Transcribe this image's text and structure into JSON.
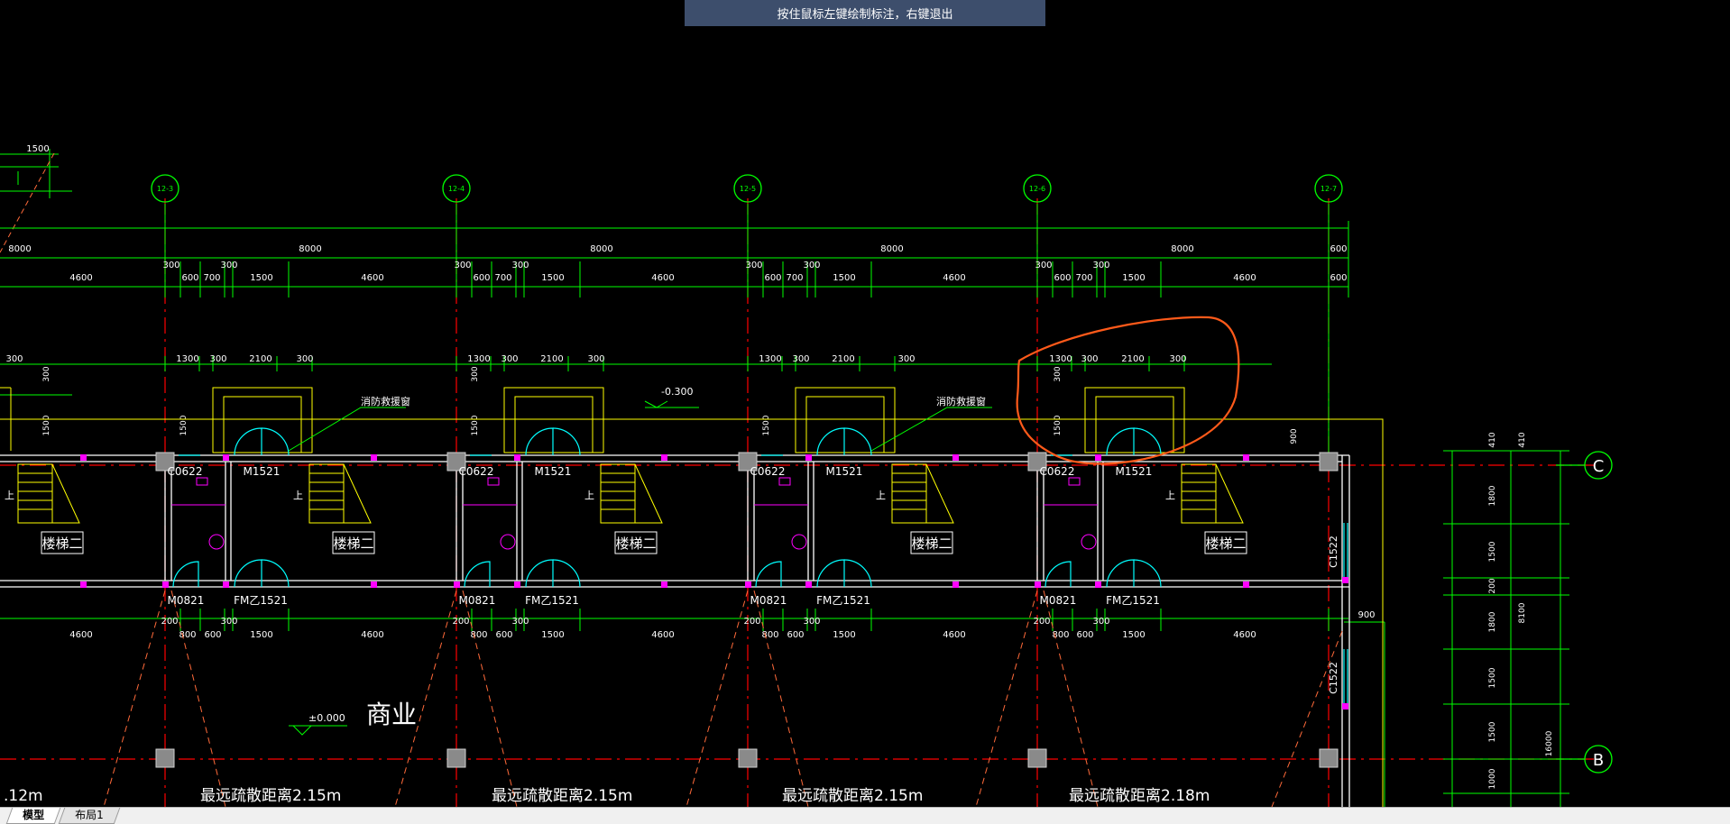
{
  "hint": "按住鼠标左键绘制标注，右键退出",
  "axes": [
    "12-3",
    "12-4",
    "12-5",
    "12-6",
    "12-7"
  ],
  "row_axes": [
    "C",
    "B"
  ],
  "dims": {
    "top_left_small": "1500",
    "overall": [
      "8000",
      "8000",
      "8000",
      "8000",
      "8000",
      "600"
    ],
    "second": [
      "4600",
      "4600",
      "4600",
      "4600",
      "4600",
      "600"
    ],
    "m300": "300",
    "m600": "600",
    "m700": "700",
    "m1500": "1500",
    "m1300": "1300",
    "m2100": "2100",
    "m200": "200",
    "m800": "800",
    "m900": "900",
    "m1800": "1800",
    "m410": "410",
    "m1000": "1000",
    "m8100": "8100",
    "m16000": "16000"
  },
  "labels": {
    "window": "C0622",
    "door": "M1521",
    "door_small": "M0821",
    "fire_door": "FM乙1521",
    "stair": "楼梯二",
    "rescue_window": "消防救援窗",
    "rescue_window2": "消防救援窗",
    "level_top": "-0.300",
    "level_ground": "±0.000",
    "commercial": "商业",
    "side_window": "C1522",
    "up": "上"
  },
  "distances": [
    "最远疏散距离2.15m",
    "最远疏散距离2.15m",
    "最远疏散距离2.15m",
    "最远疏散距离2.18m"
  ],
  "left_cut": ".12m",
  "tabs": [
    "模型",
    "布局1"
  ]
}
